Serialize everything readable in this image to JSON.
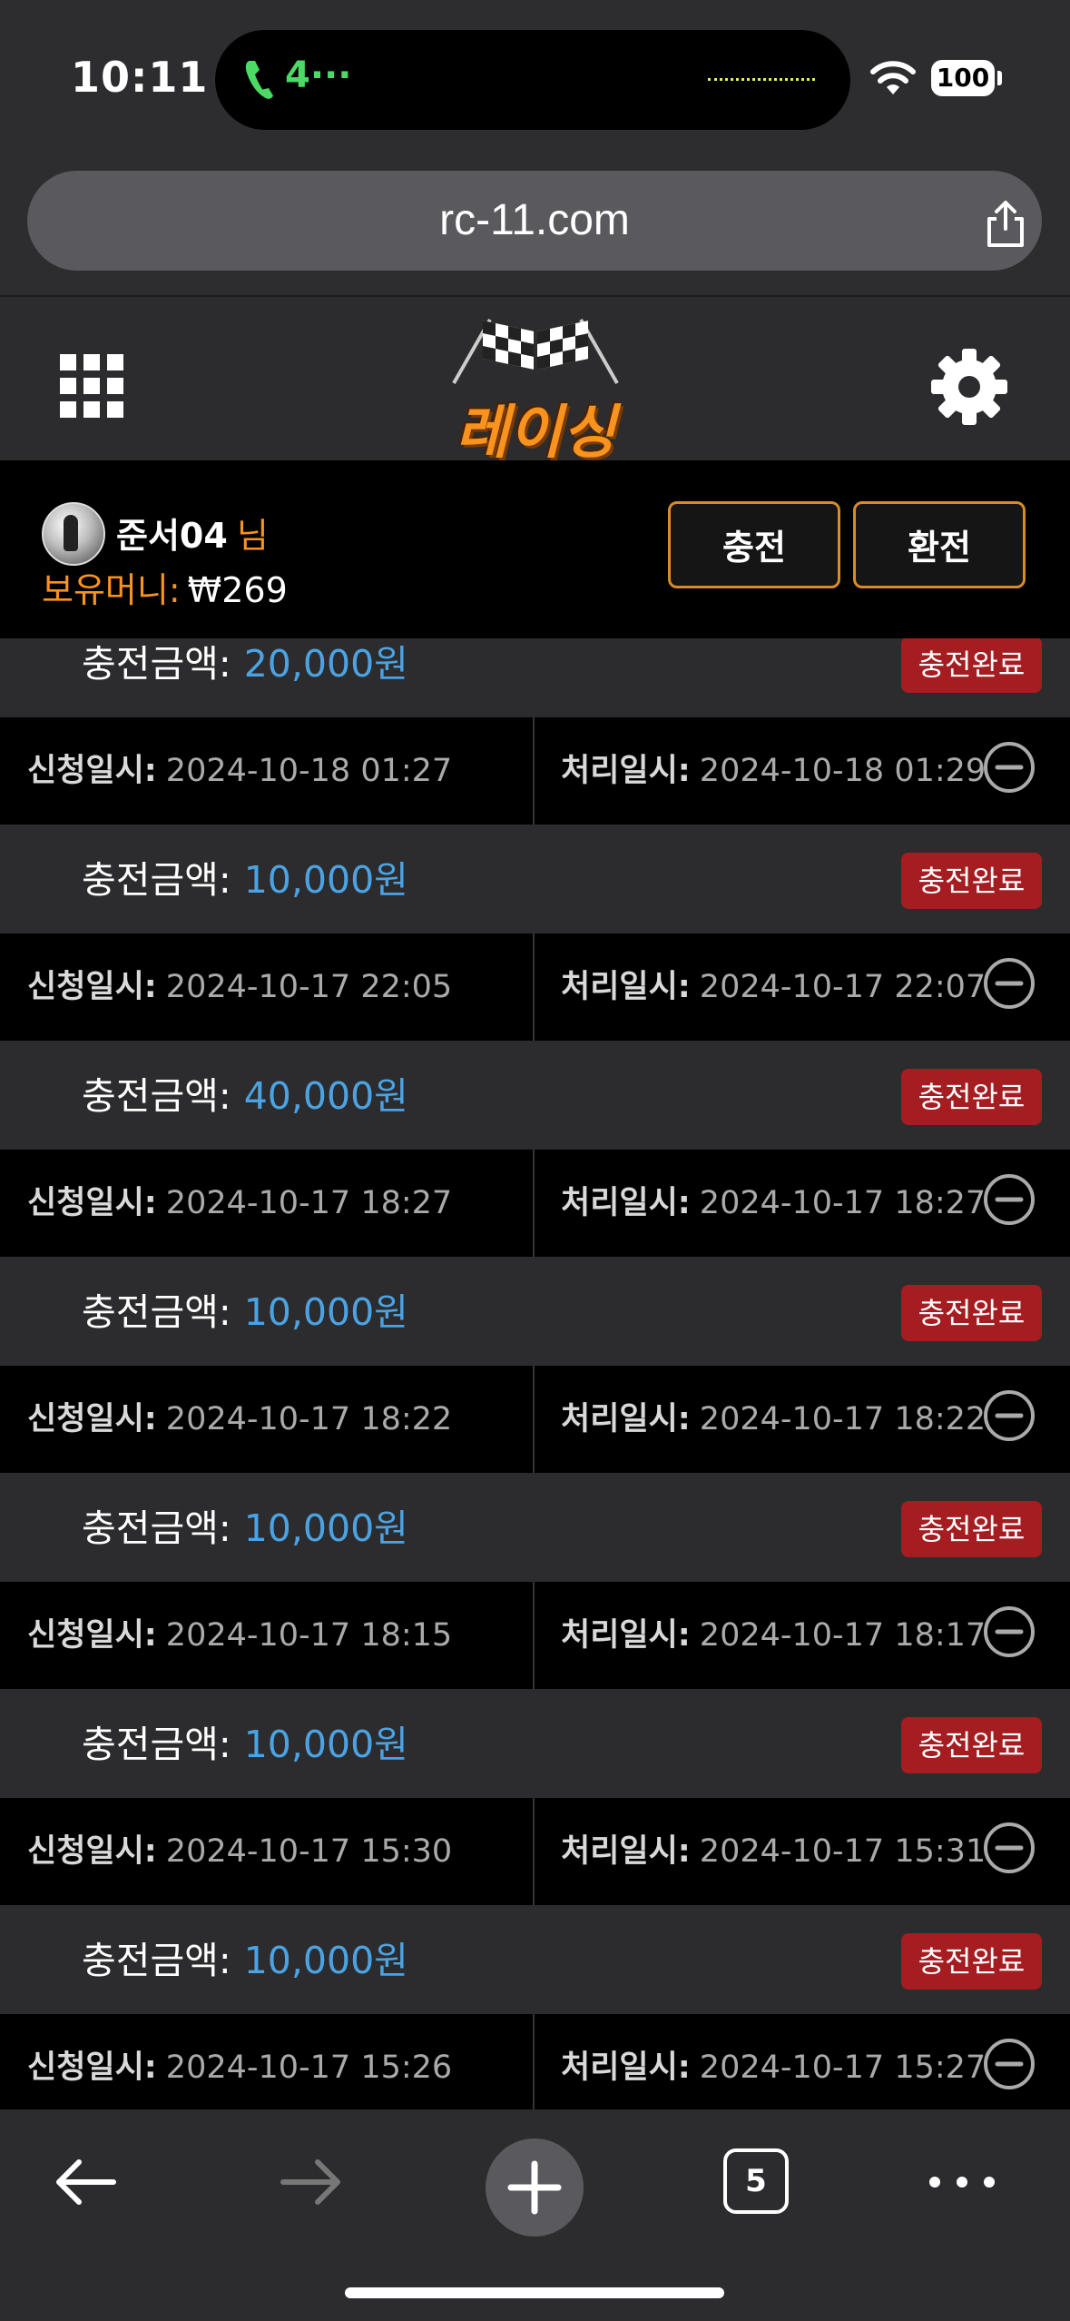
{
  "status_bar": {
    "time": "10:11",
    "call_text": "4···",
    "battery": "100"
  },
  "browser": {
    "url": "rc-11.com",
    "tabs_count": "5"
  },
  "site": {
    "logo_text": "레이싱"
  },
  "user": {
    "name": "준서04",
    "honorific": "님",
    "money_label": "보유머니:",
    "money_value": "₩269"
  },
  "buttons": {
    "charge": "충전",
    "exchange": "환전"
  },
  "labels": {
    "amount": "충전금액:",
    "request": "신청일시:",
    "processed": "처리일시:"
  },
  "records": [
    {
      "amount": "20,000원",
      "status": "충전완료",
      "requested": "2024-10-18 01:27",
      "processed": "2024-10-18 01:29"
    },
    {
      "amount": "10,000원",
      "status": "충전완료",
      "requested": "2024-10-17 22:05",
      "processed": "2024-10-17 22:07"
    },
    {
      "amount": "40,000원",
      "status": "충전완료",
      "requested": "2024-10-17 18:27",
      "processed": "2024-10-17 18:27"
    },
    {
      "amount": "10,000원",
      "status": "충전완료",
      "requested": "2024-10-17 18:22",
      "processed": "2024-10-17 18:22"
    },
    {
      "amount": "10,000원",
      "status": "충전완료",
      "requested": "2024-10-17 18:15",
      "processed": "2024-10-17 18:17"
    },
    {
      "amount": "10,000원",
      "status": "충전완료",
      "requested": "2024-10-17 15:30",
      "processed": "2024-10-17 15:31"
    },
    {
      "amount": "10,000원",
      "status": "충전완료",
      "requested": "2024-10-17 15:26",
      "processed": "2024-10-17 15:27"
    }
  ],
  "colors": {
    "accent": "#f7931e",
    "amount": "#4ba3e3",
    "badge": "#a51d21"
  },
  "icons": [
    "phone-icon",
    "wifi-icon",
    "share-icon",
    "grid-menu-icon",
    "gear-icon",
    "minus-circle-icon",
    "back-arrow-icon",
    "forward-arrow-icon",
    "plus-icon",
    "more-icon"
  ]
}
